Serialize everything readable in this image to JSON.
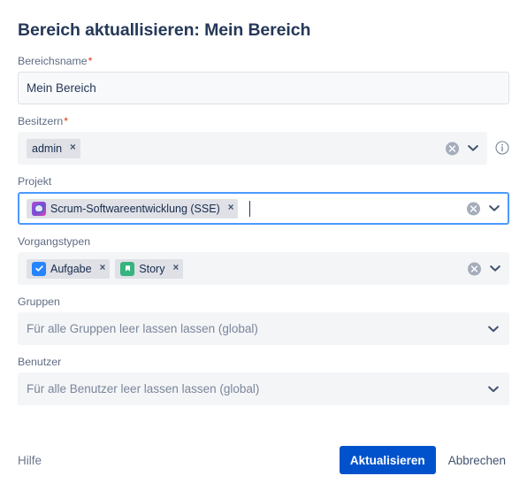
{
  "dialog": {
    "title": "Bereich aktuallisieren: Mein Bereich"
  },
  "fields": {
    "name": {
      "label": "Bereichsname",
      "required": true,
      "required_mark": "*",
      "value": "Mein Bereich",
      "placeholder": ""
    },
    "owners": {
      "label": "Besitzern",
      "required": true,
      "required_mark": "*",
      "chips": [
        {
          "label": "admin",
          "icon": "none",
          "remove": "×"
        }
      ],
      "clear_icon": "clear-circle-icon",
      "chevron": "chevron-down-icon",
      "info_icon": "info-circle-icon"
    },
    "project": {
      "label": "Projekt",
      "required": false,
      "focused": true,
      "chips": [
        {
          "label": "Scrum-Softwareentwicklung (SSE)",
          "icon": "project-avatar-icon",
          "remove": "×"
        }
      ],
      "clear_icon": "clear-circle-icon",
      "chevron": "chevron-down-icon"
    },
    "issue_types": {
      "label": "Vorgangstypen",
      "required": false,
      "chips": [
        {
          "label": "Aufgabe",
          "icon": "task-check-icon",
          "remove": "×"
        },
        {
          "label": "Story",
          "icon": "story-bookmark-icon",
          "remove": "×"
        }
      ],
      "clear_icon": "clear-circle-icon",
      "chevron": "chevron-down-icon"
    },
    "groups": {
      "label": "Gruppen",
      "required": false,
      "placeholder": "Für alle Gruppen leer lassen lassen (global)",
      "chevron": "chevron-down-icon"
    },
    "users": {
      "label": "Benutzer",
      "required": false,
      "placeholder": "Für alle Benutzer leer lassen lassen (global)",
      "chevron": "chevron-down-icon"
    }
  },
  "footer": {
    "help_label": "Hilfe",
    "submit_label": "Aktualisieren",
    "cancel_label": "Abbrechen"
  },
  "colors": {
    "primary_button": "#0052cc",
    "focus_border": "#4c9aff",
    "required_star": "#de350b",
    "field_bg": "#f4f5f7",
    "input_bg": "#f8f9fb",
    "label_text": "#5e6c84",
    "title_text": "#253858",
    "task_icon": "#2684ff",
    "story_icon": "#36b37e"
  }
}
